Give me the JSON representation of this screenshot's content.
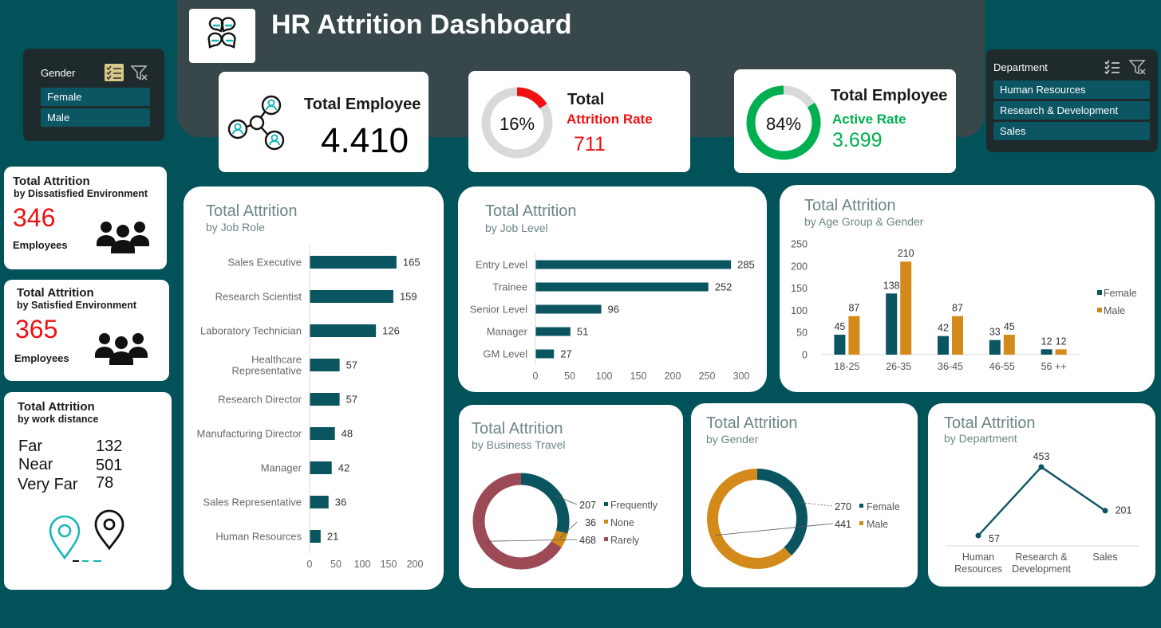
{
  "header": {
    "title": "HR Attrition Dashboard",
    "logo_icon": "team-chat-icon"
  },
  "slicers": {
    "gender": {
      "title": "Gender",
      "items": [
        "Female",
        "Male"
      ]
    },
    "department": {
      "title": "Department",
      "items": [
        "Human Resources",
        "Research & Development",
        "Sales"
      ]
    }
  },
  "kpis": {
    "total_employee": {
      "title": "Total Employee",
      "value": "4.410"
    },
    "attrition": {
      "title": "Total",
      "subtitle": "Attrition Rate",
      "percent": "16%",
      "percent_value": 16,
      "value": "711"
    },
    "active": {
      "title": "Total Employee",
      "subtitle": "Active Rate",
      "percent": "84%",
      "percent_value": 84,
      "value": "3.699"
    }
  },
  "left_cards": {
    "dissatisfied": {
      "title": "Total Attrition",
      "subtitle": "by Dissatisfied Environment",
      "value": "346",
      "unit": "Employees"
    },
    "satisfied": {
      "title": "Total Attrition",
      "subtitle": "by Satisfied Environment",
      "value": "365",
      "unit": "Employees"
    },
    "distance": {
      "title": "Total Attrition",
      "subtitle": "by work distance",
      "rows": [
        {
          "label": "Far",
          "value": "132"
        },
        {
          "label": "Near",
          "value": "501"
        },
        {
          "label": "Very Far",
          "value": "78"
        }
      ]
    }
  },
  "colors": {
    "teal": "#0b5560",
    "orange": "#d48a1a",
    "rose": "#9c4a55",
    "red": "#ee1111",
    "green": "#00b050",
    "ring_bg": "#d9d9d9"
  },
  "chart_data": [
    {
      "id": "job_role",
      "type": "bar",
      "title": "Total Attrition",
      "subtitle": "by Job Role",
      "categories": [
        "Sales Executive",
        "Research Scientist",
        "Laboratory Technician",
        "Healthcare Representative",
        "Research Director",
        "Manufacturing Director",
        "Manager",
        "Sales Representative",
        "Human Resources"
      ],
      "values": [
        165,
        159,
        126,
        57,
        57,
        48,
        42,
        36,
        21
      ],
      "xlim": [
        0,
        200
      ],
      "ticks": [
        0,
        50,
        100,
        150,
        200
      ]
    },
    {
      "id": "job_level",
      "type": "bar",
      "title": "Total Attrition",
      "subtitle": "by Job Level",
      "categories": [
        "Entry Level",
        "Trainee",
        "Senior Level",
        "Manager",
        "GM Level"
      ],
      "values": [
        285,
        252,
        96,
        51,
        27
      ],
      "xlim": [
        0,
        300
      ],
      "ticks": [
        0,
        50,
        100,
        150,
        200,
        250,
        300
      ]
    },
    {
      "id": "age_gender",
      "type": "bar",
      "title": "Total Attrition",
      "subtitle": "by Age Group & Gender",
      "categories": [
        "18-25",
        "26-35",
        "36-45",
        "46-55",
        "56 ++"
      ],
      "series": [
        {
          "name": "Female",
          "values": [
            45,
            138,
            42,
            33,
            12
          ]
        },
        {
          "name": "Male",
          "values": [
            87,
            210,
            87,
            45,
            12
          ]
        }
      ],
      "ylim": [
        0,
        250
      ],
      "ticks": [
        0,
        50,
        100,
        150,
        200,
        250
      ],
      "legend": "right"
    },
    {
      "id": "business_travel",
      "type": "pie",
      "title": "Total Attrition",
      "subtitle": "by Business Travel",
      "categories": [
        "Frequently",
        "None",
        "Rarely"
      ],
      "values": [
        207,
        36,
        468
      ]
    },
    {
      "id": "gender",
      "type": "pie",
      "title": "Total Attrition",
      "subtitle": "by Gender",
      "categories": [
        "Female",
        "Male"
      ],
      "values": [
        270,
        441
      ]
    },
    {
      "id": "department",
      "type": "line",
      "title": "Total Attrition",
      "subtitle": "by Department",
      "categories": [
        "Human Resources",
        "Research & Development",
        "Sales"
      ],
      "values": [
        57,
        453,
        201
      ]
    }
  ]
}
